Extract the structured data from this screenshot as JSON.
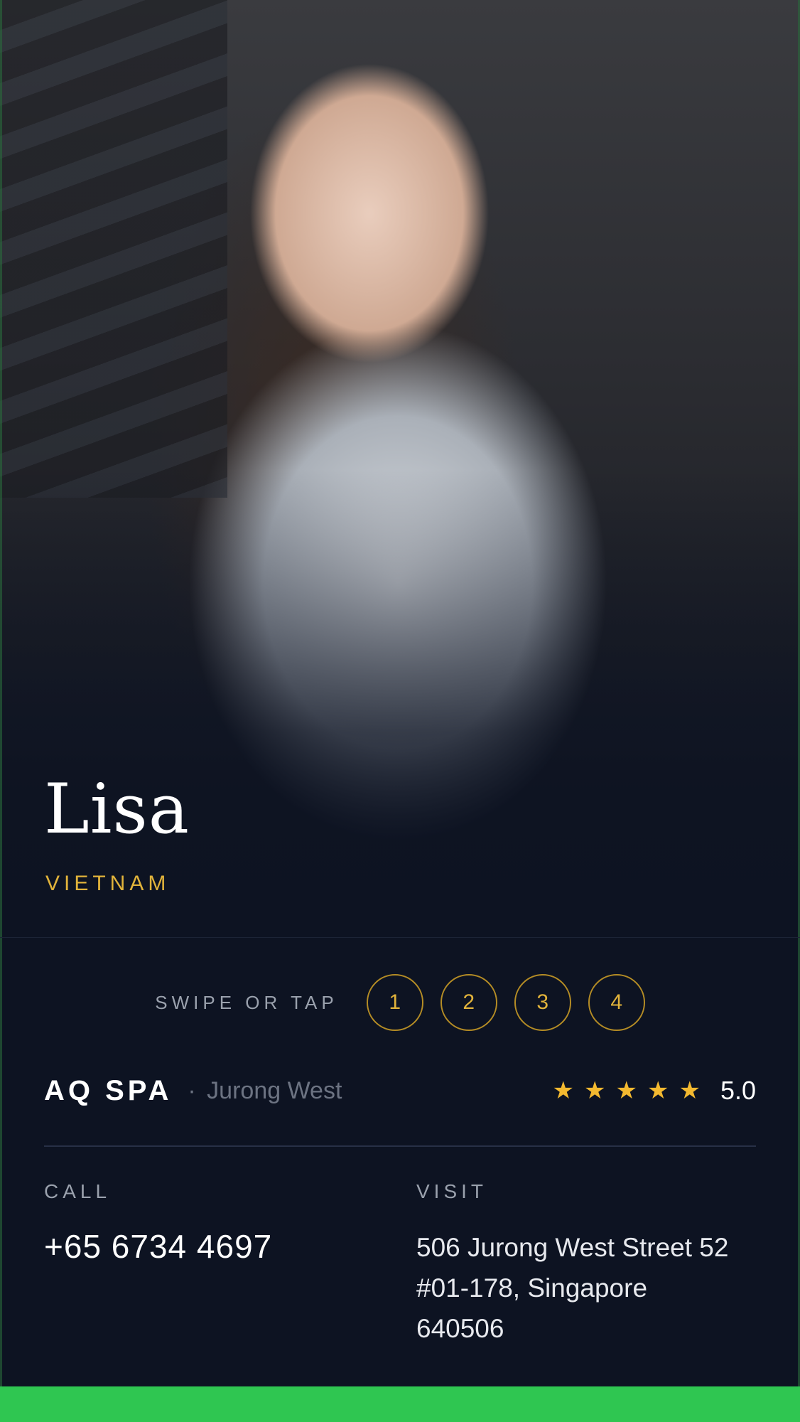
{
  "profile": {
    "name": "Lisa",
    "country": "VIETNAM"
  },
  "gallery": {
    "swipe_label": "SWIPE OR TAP",
    "pages": [
      "1",
      "2",
      "3",
      "4"
    ]
  },
  "spa": {
    "name": "AQ SPA",
    "separator": "·",
    "location": "Jurong West",
    "rating": "5.0",
    "stars": 5
  },
  "contact": {
    "call_label": "CALL",
    "phone": "+65 6734 4697",
    "visit_label": "VISIT",
    "address_lines": [
      "506 Jurong West Street 52",
      "#01-178, Singapore",
      "640506"
    ]
  },
  "colors": {
    "accent_gold": "#e1b33b",
    "star": "#f3b930",
    "background": "#0d1322",
    "cta_green": "#2fc651"
  }
}
